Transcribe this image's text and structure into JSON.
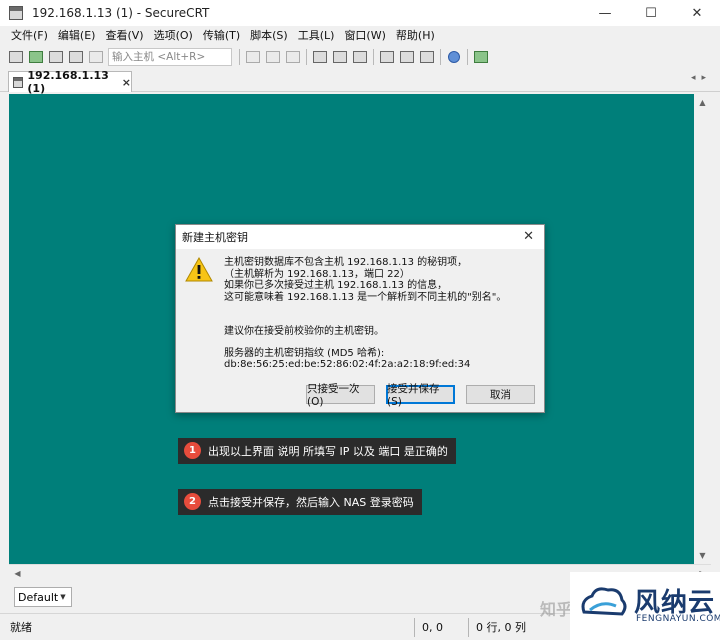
{
  "window": {
    "title": "192.168.1.13 (1) - SecureCRT",
    "controls": [
      "—",
      "☐",
      "✕"
    ]
  },
  "menu": [
    "文件(F)",
    "编辑(E)",
    "查看(V)",
    "选项(O)",
    "传输(T)",
    "脚本(S)",
    "工具(L)",
    "窗口(W)",
    "帮助(H)"
  ],
  "toolbar": {
    "quick_connect_placeholder": "输入主机 <Alt+R>"
  },
  "tab": {
    "label": "192.168.1.13 (1)",
    "close": "×",
    "nav_arrows": "◂▸"
  },
  "dialog": {
    "title": "新建主机密钥",
    "close": "✕",
    "lines": [
      "主机密钥数据库不包含主机 192.168.1.13 的秘钥项，",
      "（主机解析为 192.168.1.13，端口 22）",
      "如果你已多次接受过主机 192.168.1.13 的信息，",
      "这可能意味着 192.168.1.13 是一个解析到不同主机的\"别名\"。"
    ],
    "advice": "建议你在接受前校验你的主机密钥。",
    "fingerprint_label": "服务器的主机密钥指纹 (MD5 哈希):",
    "fingerprint": "db:8e:56:25:ed:be:52:86:02:4f:2a:a2:18:9f:ed:34",
    "buttons": {
      "accept_once": "只接受一次(O)",
      "accept_save": "接受并保存(S)",
      "cancel": "取消"
    }
  },
  "annotations": [
    {
      "num": "1",
      "text": "出现以上界面 说明 所填写 IP  以及 端口 是正确的"
    },
    {
      "num": "2",
      "text": "点击接受并保存，然后输入 NAS 登录密码"
    }
  ],
  "session": {
    "value": "Default"
  },
  "status": {
    "ready": "就绪",
    "position": "0, 0",
    "rowcol": "0 行, 0 列"
  },
  "watermark": {
    "zhihu": "知乎",
    "brand": "风纳云",
    "brand_sub": "FENGNAYUN.COM"
  },
  "colors": {
    "terminal_bg": "#007f7a",
    "badge": "#e74c3c",
    "note_bg": "#2b2b2b"
  }
}
